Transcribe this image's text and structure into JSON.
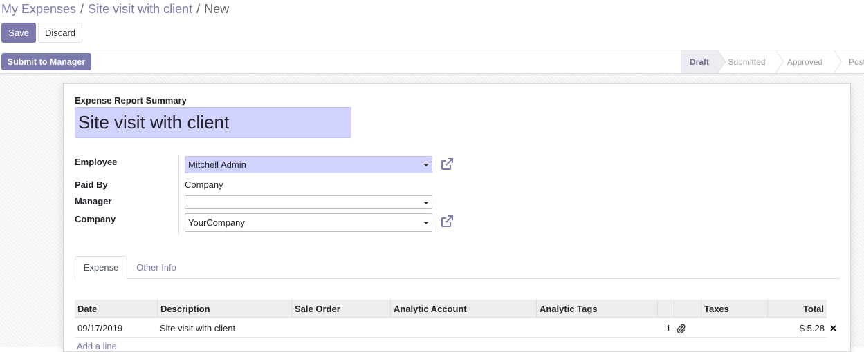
{
  "breadcrumb": {
    "parent": "My Expenses",
    "record": "Site visit with client",
    "current": "New",
    "separator": "/"
  },
  "buttons": {
    "save": "Save",
    "discard": "Discard",
    "submit": "Submit to Manager"
  },
  "status": {
    "steps": [
      "Draft",
      "Submitted",
      "Approved",
      "Post"
    ],
    "active": "Draft"
  },
  "form": {
    "summary_label": "Expense Report Summary",
    "summary_value": "Site visit with client",
    "employee_label": "Employee",
    "employee_value": "Mitchell Admin",
    "paid_by_label": "Paid By",
    "paid_by_value": "Company",
    "manager_label": "Manager",
    "manager_value": "",
    "company_label": "Company",
    "company_value": "YourCompany"
  },
  "tabs": {
    "expense": "Expense",
    "other_info": "Other Info"
  },
  "table": {
    "headers": {
      "date": "Date",
      "description": "Description",
      "sale_order": "Sale Order",
      "analytic_account": "Analytic Account",
      "analytic_tags": "Analytic Tags",
      "taxes": "Taxes",
      "total": "Total"
    },
    "rows": [
      {
        "date": "09/17/2019",
        "description": "Site visit with client",
        "quantity": "1",
        "total": "$ 5.28"
      }
    ],
    "add_line": "Add a line"
  },
  "colors": {
    "accent": "#7c7bad",
    "required_field": "#d2d2ff"
  },
  "icons": {
    "external_link": "external-link-icon",
    "attachment": "paperclip-icon",
    "delete": "close-icon",
    "dropdown": "caret-down-icon"
  }
}
